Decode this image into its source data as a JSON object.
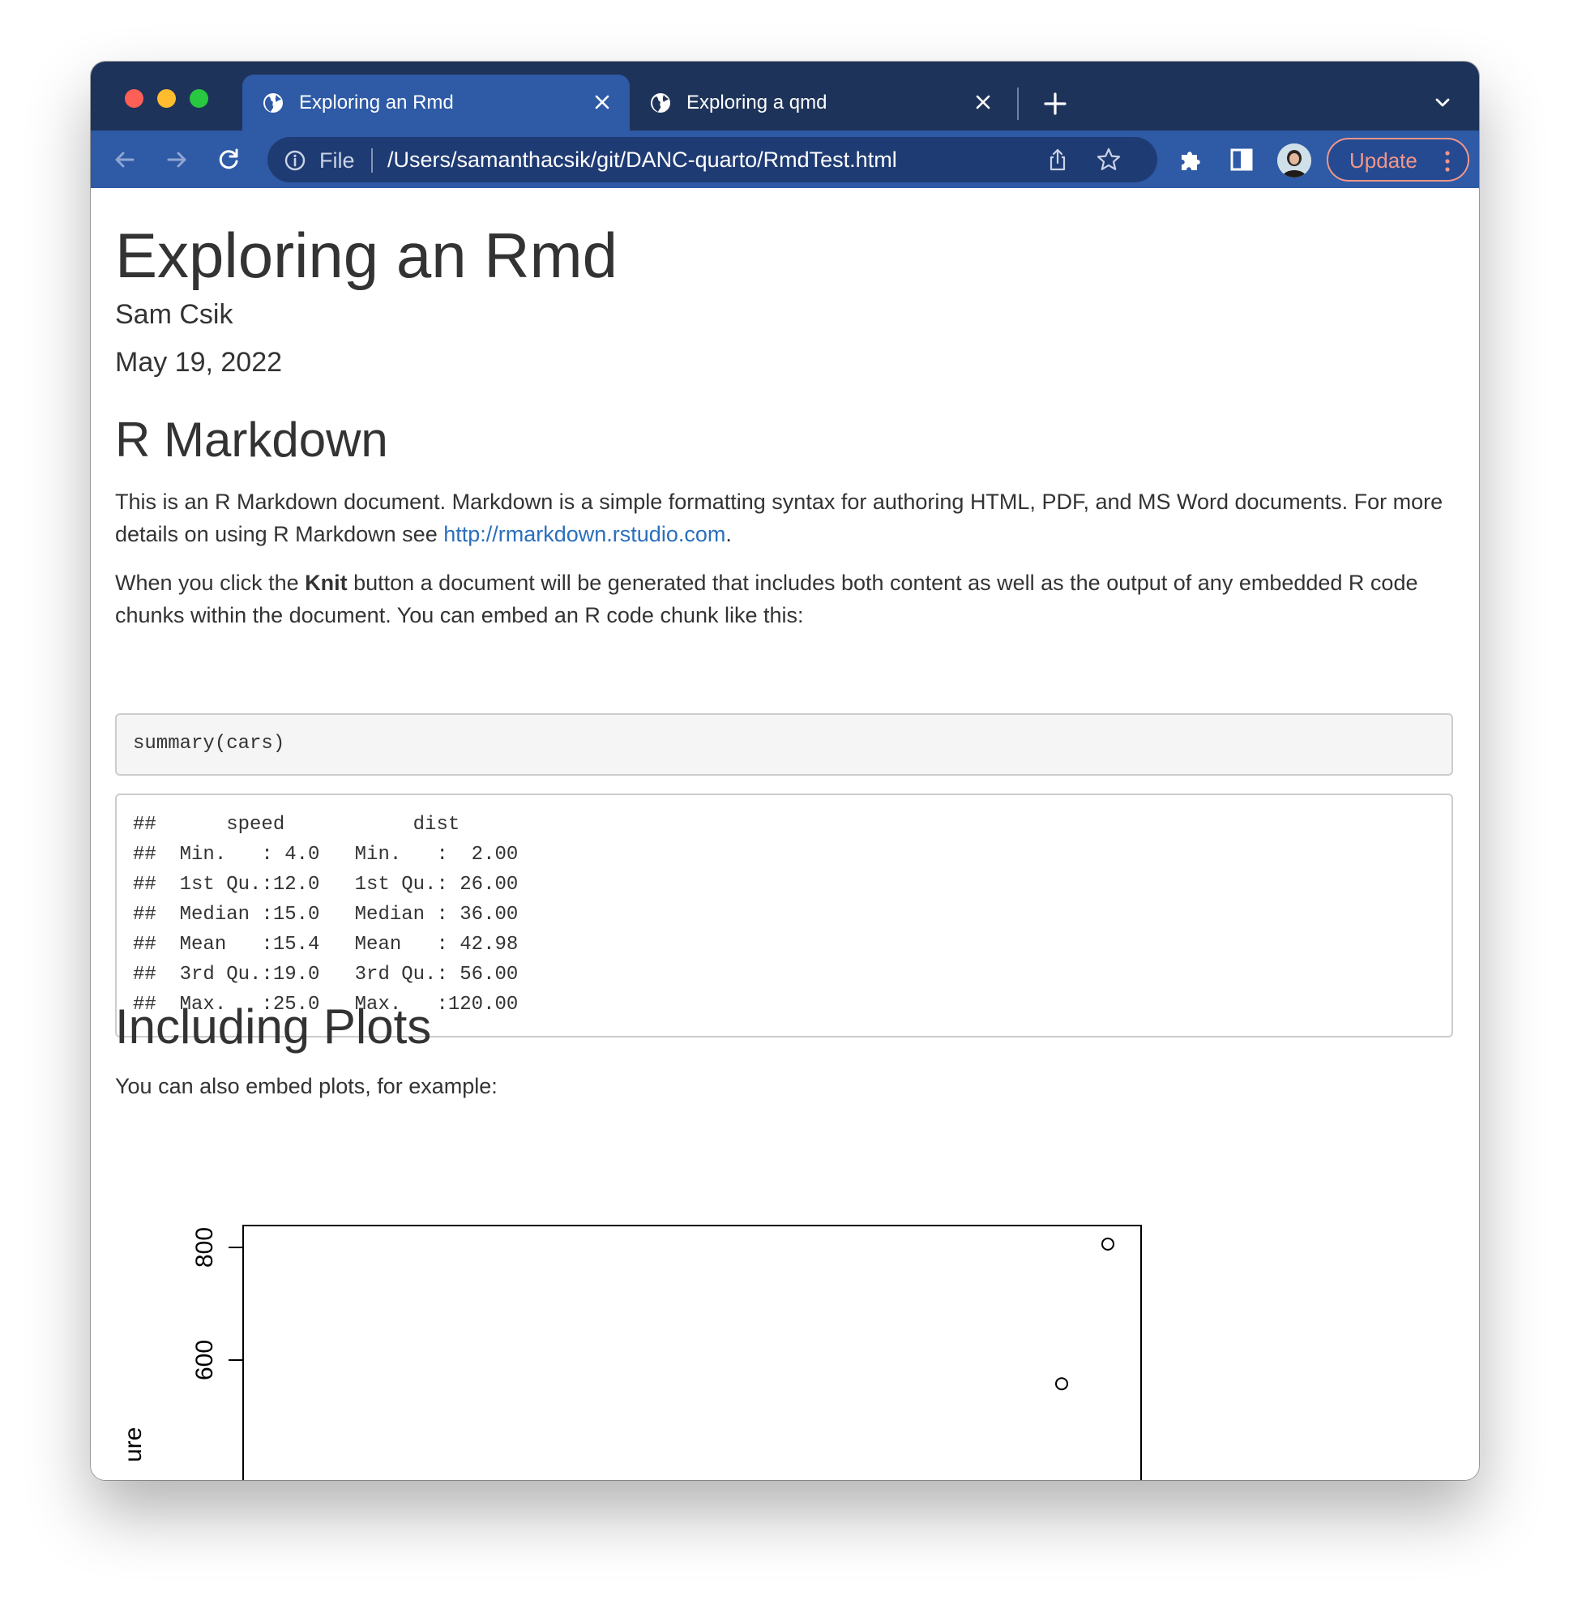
{
  "browser": {
    "tabs": [
      {
        "title": "Exploring an Rmd",
        "active": true
      },
      {
        "title": "Exploring a qmd",
        "active": false
      }
    ],
    "address": {
      "scheme_label": "File",
      "url": "/Users/samanthacsik/git/DANC-quarto/RmdTest.html"
    },
    "update_label": "Update",
    "colors": {
      "tabbar": "#1e3359",
      "toolbar": "#2e5aa6",
      "update_text": "#f29689"
    }
  },
  "document": {
    "title": "Exploring an Rmd",
    "author": "Sam Csik",
    "date": "May 19, 2022",
    "section1": {
      "heading": "R Markdown",
      "p1_text": "This is an R Markdown document. Markdown is a simple formatting syntax for authoring HTML, PDF, and MS Word documents. For more details on using R Markdown see ",
      "p1_link": "http://rmarkdown.rstudio.com",
      "p1_end": ".",
      "p2_before": "When you click the ",
      "p2_bold": "Knit",
      "p2_after": " button a document will be generated that includes both content as well as the output of any embedded R code chunks within the document. You can embed an R code chunk like this:",
      "code": "summary(cars)",
      "output": [
        "##      speed           dist       ",
        "##  Min.   : 4.0   Min.   :  2.00  ",
        "##  1st Qu.:12.0   1st Qu.: 26.00  ",
        "##  Median :15.0   Median : 36.00  ",
        "##  Mean   :15.4   Mean   : 42.98  ",
        "##  3rd Qu.:19.0   3rd Qu.: 56.00  ",
        "##  Max.   :25.0   Max.   :120.00  "
      ]
    },
    "section2": {
      "heading": "Including Plots",
      "p1": "You can also embed plots, for example:"
    },
    "link_color": "#2a6fbd"
  },
  "chart_data": {
    "type": "scatter",
    "ylabel_partial": "ure",
    "yticks": [
      "800",
      "600"
    ],
    "points": [
      {
        "y": 806
      },
      {
        "y": 558
      }
    ]
  }
}
